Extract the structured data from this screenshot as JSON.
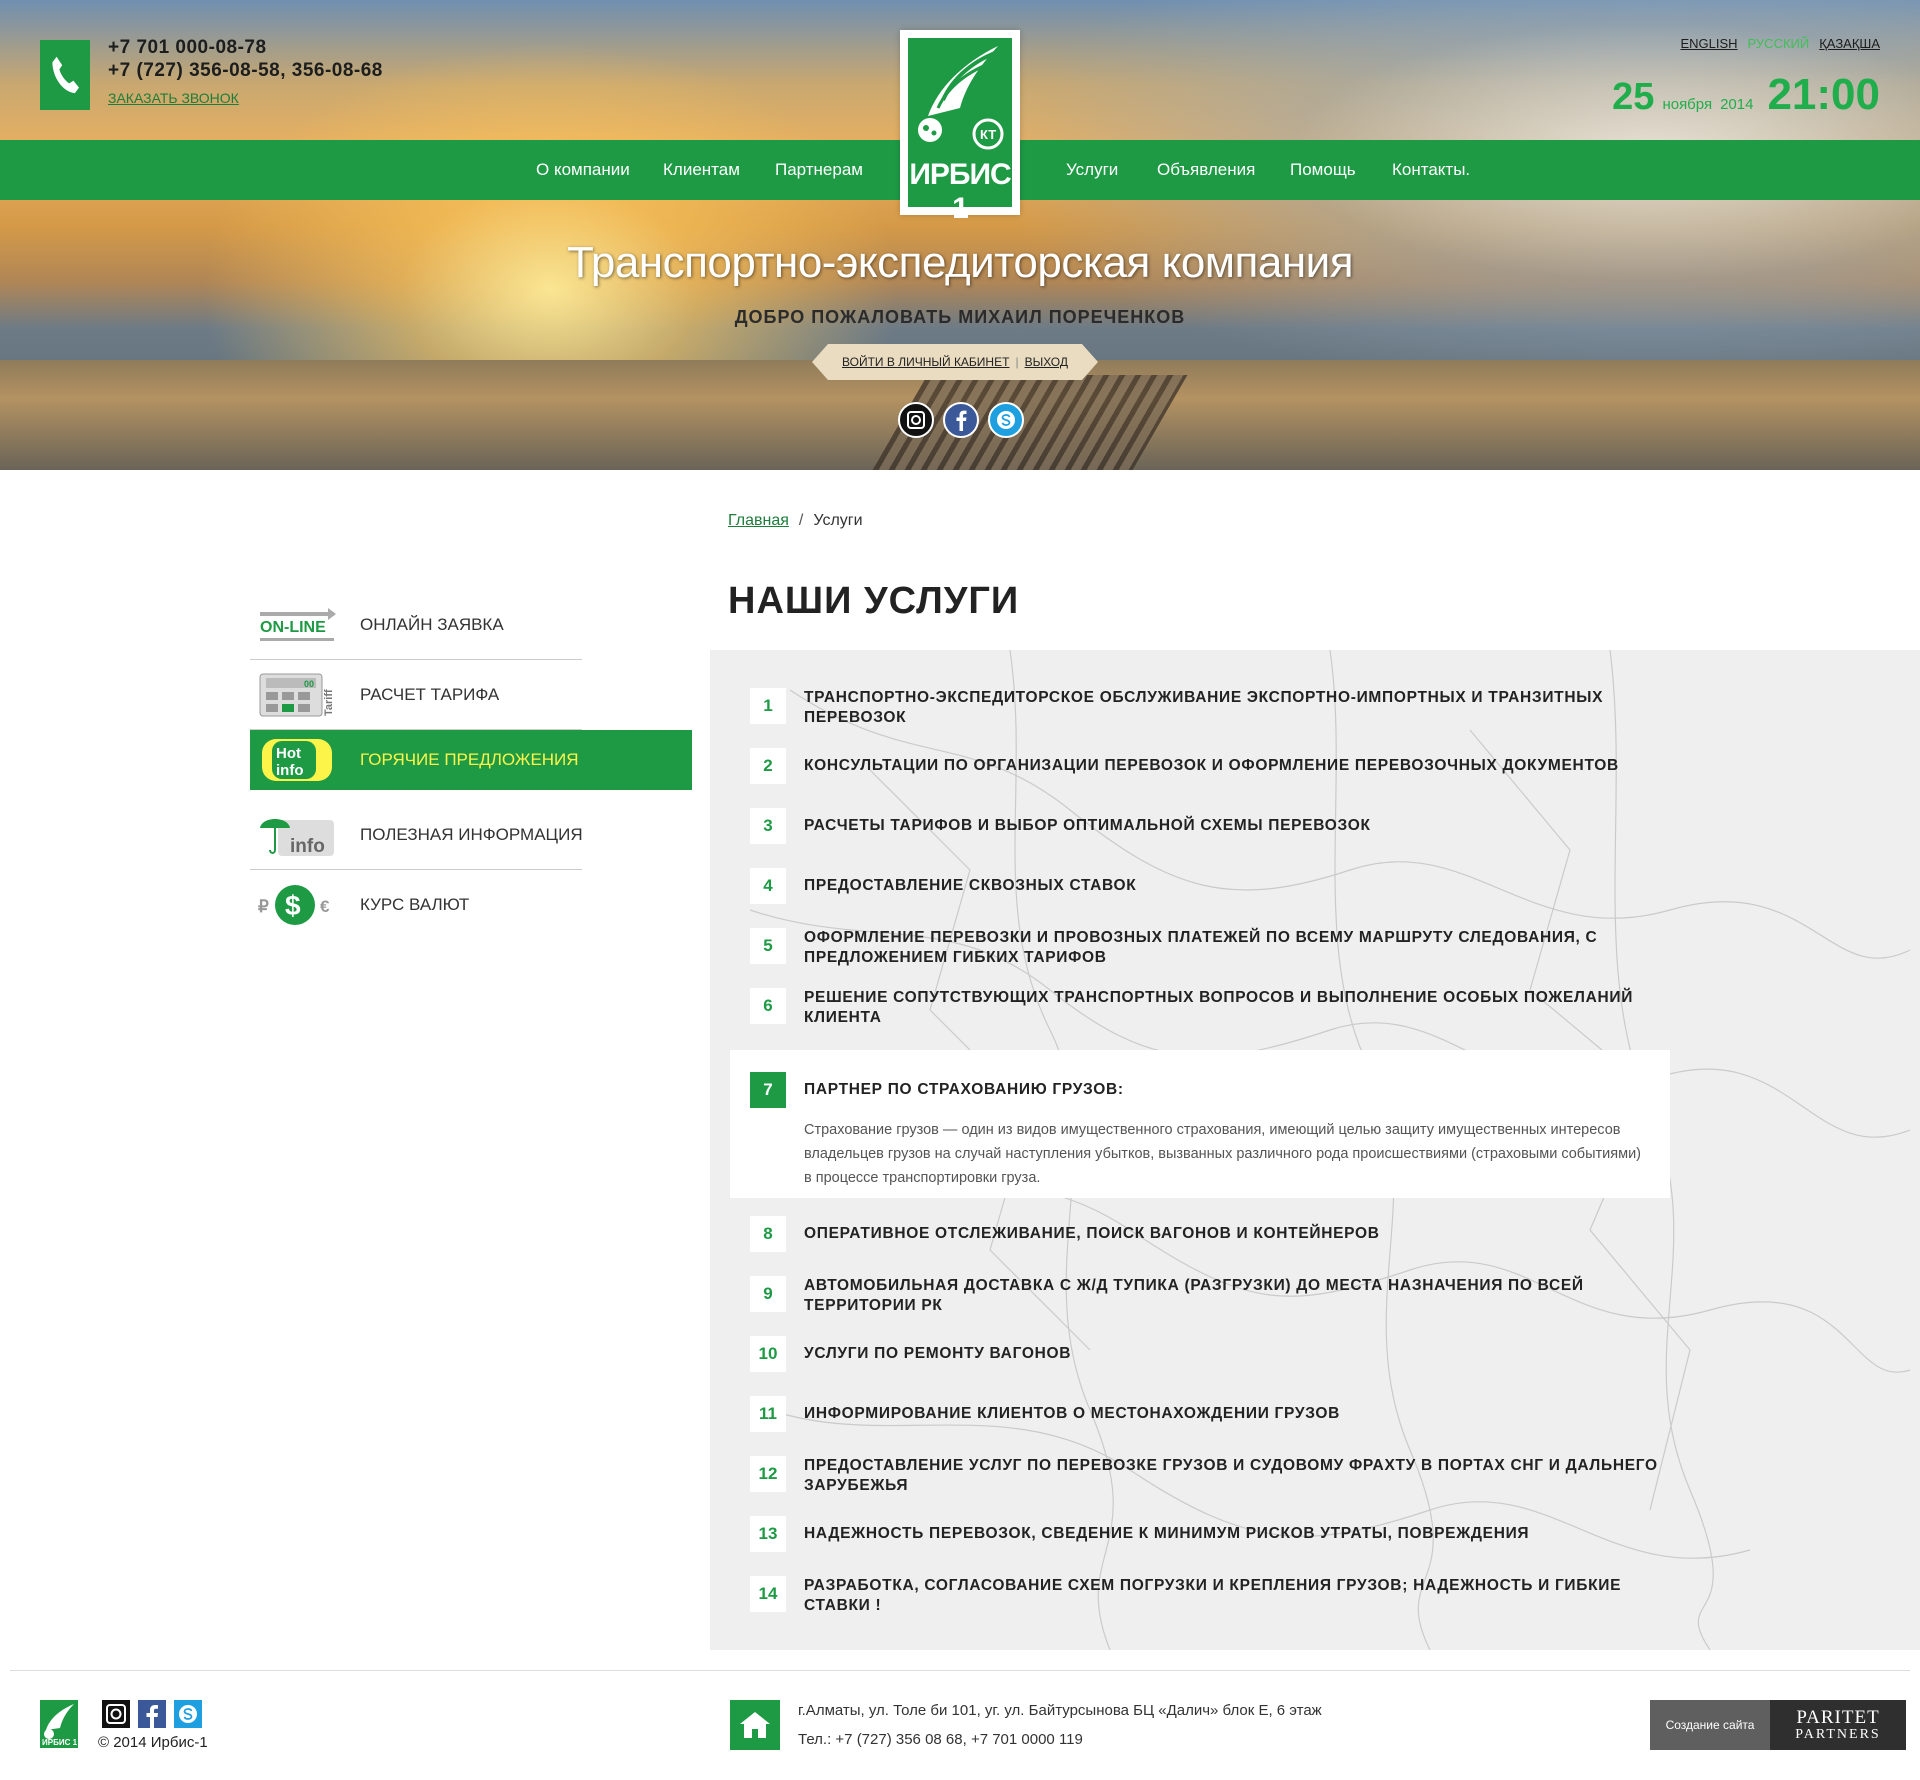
{
  "header": {
    "phone1": "+7 701 000-08-78",
    "phone2": "+7 (727) 356-08-58, 356-08-68",
    "callback": "ЗАКАЗАТЬ ЗВОНОК",
    "languages": [
      "ENGLISH",
      "РУССКИЙ",
      "ҚАЗАҚША"
    ],
    "active_language": "РУССКИЙ",
    "date_day": "25",
    "date_month": "ноября",
    "date_year": "2014",
    "time": "21:00",
    "logo_text": "ИРБИС 1",
    "logo_badge": "КТ"
  },
  "nav": {
    "left": [
      "О компании",
      "Клиентам",
      "Партнерам"
    ],
    "right": [
      "Услуги",
      "Объявления",
      "Помощь",
      "Контакты."
    ]
  },
  "hero": {
    "title": "Транспортно-экспедиторская компания",
    "welcome": "ДОБРО ПОЖАЛОВАТЬ МИХАИЛ ПОРЕЧЕНКОВ",
    "cabinet_link": "ВОЙТИ В ЛИЧНЫЙ КАБИНЕТ",
    "logout_link": "ВЫХОД",
    "separator": "|"
  },
  "breadcrumb": {
    "home": "Главная",
    "separator": "/",
    "current": "Услуги"
  },
  "page_title": "НАШИ УСЛУГИ",
  "sidebar": {
    "items": [
      {
        "label": "ОНЛАЙН ЗАЯВКА",
        "icon": "online-icon",
        "icon_text": "ON-LINE",
        "active": false
      },
      {
        "label": "РАСЧЕТ ТАРИФА",
        "icon": "calculator-icon",
        "icon_text": "Tariff",
        "icon_display": "00",
        "active": false
      },
      {
        "label": "ГОРЯЧИЕ ПРЕДЛОЖЕНИЯ",
        "icon": "hot-info-icon",
        "icon_text": "Hot info",
        "active": true
      },
      {
        "label": "ПОЛЕЗНАЯ ИНФОРМАЦИЯ",
        "icon": "umbrella-info-icon",
        "icon_text": "info",
        "active": false
      },
      {
        "label": "КУРС ВАЛЮТ",
        "icon": "currency-icon",
        "icon_text": "₽$€",
        "active": false
      }
    ]
  },
  "services": [
    {
      "num": "1",
      "text": "ТРАНСПОРТНО-ЭКСПЕДИТОРСКОЕ ОБСЛУЖИВАНИЕ ЭКСПОРТНО-ИМПОРТНЫХ И ТРАНЗИТНЫХ ПЕРЕВОЗОК"
    },
    {
      "num": "2",
      "text": "КОНСУЛЬТАЦИИ ПО ОРГАНИЗАЦИИ ПЕРЕВОЗОК И ОФОРМЛЕНИЕ ПЕРЕВОЗОЧНЫХ ДОКУМЕНТОВ"
    },
    {
      "num": "3",
      "text": "РАСЧЕТЫ ТАРИФОВ И ВЫБОР ОПТИМАЛЬНОЙ СХЕМЫ ПЕРЕВОЗОК"
    },
    {
      "num": "4",
      "text": "ПРЕДОСТАВЛЕНИЕ СКВОЗНЫХ СТАВОК"
    },
    {
      "num": "5",
      "text": "ОФОРМЛЕНИЕ ПЕРЕВОЗКИ И ПРОВОЗНЫХ ПЛАТЕЖЕЙ ПО ВСЕМУ МАРШРУТУ СЛЕДОВАНИЯ, С ПРЕДЛОЖЕНИЕМ ГИБКИХ ТАРИФОВ"
    },
    {
      "num": "6",
      "text": "РЕШЕНИЕ СОПУТСТВУЮЩИХ ТРАНСПОРТНЫХ ВОПРОСОВ И ВЫПОЛНЕНИЕ ОСОБЫХ ПОЖЕЛАНИЙ КЛИЕНТА"
    },
    {
      "num": "7",
      "text": "ПАРТНЕР ПО СТРАХОВАНИЮ ГРУЗОВ:",
      "expanded": true,
      "description": "Страхование грузов — один из видов имущественного страхования, имеющий целью защиту имущественных интересов владельцев грузов на случай наступления убытков, вызванных различного рода происшествиями (страховыми событиями) в процессе транспортировки груза."
    },
    {
      "num": "8",
      "text": "ОПЕРАТИВНОЕ ОТСЛЕЖИВАНИЕ, ПОИСК ВАГОНОВ И КОНТЕЙНЕРОВ"
    },
    {
      "num": "9",
      "text": "АВТОМОБИЛЬНАЯ ДОСТАВКА С Ж/Д ТУПИКА (РАЗГРУЗКИ) ДО МЕСТА НАЗНАЧЕНИЯ ПО ВСЕЙ ТЕРРИТОРИИ РК"
    },
    {
      "num": "10",
      "text": "УСЛУГИ ПО РЕМОНТУ ВАГОНОВ"
    },
    {
      "num": "11",
      "text": "ИНФОРМИРОВАНИЕ КЛИЕНТОВ О МЕСТОНАХОЖДЕНИИ ГРУЗОВ"
    },
    {
      "num": "12",
      "text": "ПРЕДОСТАВЛЕНИЕ УСЛУГ ПО ПЕРЕВОЗКЕ ГРУЗОВ И СУДОВОМУ ФРАХТУ В ПОРТАХ СНГ И ДАЛЬНЕГО ЗАРУБЕЖЬЯ"
    },
    {
      "num": "13",
      "text": "НАДЕЖНОСТЬ ПЕРЕВОЗОК, СВЕДЕНИЕ К МИНИМУМ РИСКОВ УТРАТЫ, ПОВРЕЖДЕНИЯ"
    },
    {
      "num": "14",
      "text": "РАЗРАБОТКА, СОГЛАСОВАНИЕ СХЕМ ПОГРУЗКИ И КРЕПЛЕНИЯ ГРУЗОВ; НАДЕЖНОСТЬ И ГИБКИЕ СТАВКИ !"
    }
  ],
  "footer": {
    "copyright": "© 2014  Ирбис-1",
    "logo_text": "ИРБИС 1",
    "address": "г.Алматы, ул. Толе би 101, уг. ул. Байтурсынова БЦ «Далич» блок Е, 6 этаж",
    "phones": "Тел.: +7 (727) 356 08 68, +7 701 0000 119",
    "dev_label": "Создание сайта",
    "dev_name1": "PARITET",
    "dev_name2": "PARTNERS"
  },
  "colors": {
    "brand_green": "#1e9a45",
    "accent_yellow": "#fdf44a",
    "panel_bg": "#efefef"
  }
}
